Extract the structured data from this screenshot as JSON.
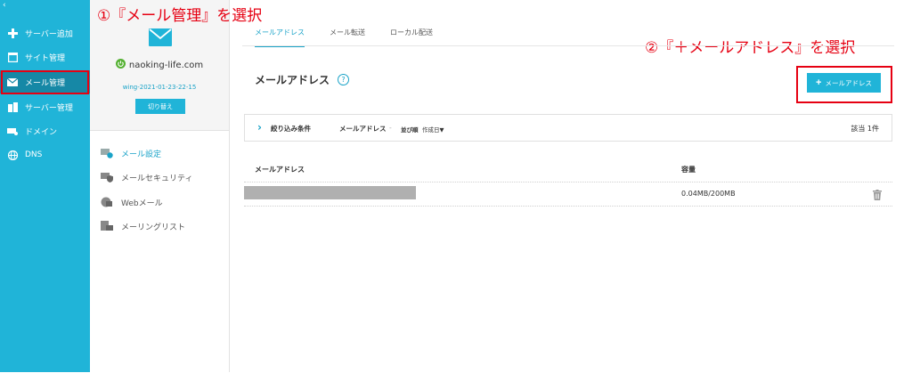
{
  "annotations": {
    "step1": "①『メール管理』を選択",
    "step2": "②『＋メールアドレス』を選択"
  },
  "nav": {
    "back_glyph": "‹",
    "items": [
      {
        "label": "サーバー追加",
        "icon": "plus-icon"
      },
      {
        "label": "サイト管理",
        "icon": "window-icon"
      },
      {
        "label": "メール管理",
        "icon": "envelope-icon",
        "active": true
      },
      {
        "label": "サーバー管理",
        "icon": "building-icon"
      },
      {
        "label": "ドメイン",
        "icon": "domain-icon"
      },
      {
        "label": "DNS",
        "icon": "globe-icon"
      }
    ]
  },
  "server": {
    "name": "naoking-life.com",
    "id": "wing-2021-01-23-22-15",
    "switch_label": "切り替え",
    "menu": [
      {
        "label": "メール設定",
        "icon": "mail-settings-icon",
        "active": true
      },
      {
        "label": "メールセキュリティ",
        "icon": "mail-security-icon"
      },
      {
        "label": "Webメール",
        "icon": "webmail-icon"
      },
      {
        "label": "メーリングリスト",
        "icon": "mailing-list-icon"
      }
    ]
  },
  "tabs": [
    {
      "label": "メールアドレス",
      "active": true
    },
    {
      "label": "メール転送"
    },
    {
      "label": "ローカル配送"
    }
  ],
  "page": {
    "title": "メールアドレス",
    "help": "?",
    "add_button": "メールアドレス",
    "add_plus": "+"
  },
  "filter": {
    "chevron": "›",
    "title": "絞り込み条件",
    "field": "メールアドレス",
    "dash": "-",
    "sort_label": "並び順",
    "sort_value": "作成日▼",
    "count": "該当 1件"
  },
  "table": {
    "headers": {
      "address": "メールアドレス",
      "capacity": "容量"
    },
    "rows": [
      {
        "capacity": "0.04MB/200MB"
      }
    ]
  },
  "colors": {
    "accent": "#20b4d8",
    "nav_active": "#1688a6",
    "annotation": "#e60012"
  }
}
